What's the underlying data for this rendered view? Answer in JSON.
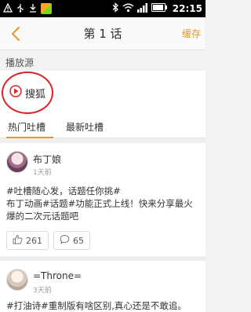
{
  "status_bar": {
    "time": "22:15"
  },
  "header": {
    "title": "第 1 话",
    "cache_label": "缓存"
  },
  "source": {
    "section_label": "播放源",
    "selected": "搜狐"
  },
  "tabs": [
    {
      "label": "热门吐槽",
      "active": true
    },
    {
      "label": "最新吐槽",
      "active": false
    }
  ],
  "posts": [
    {
      "username": "布丁娘",
      "time": "1天前",
      "text": "#吐槽随心发，话题任你挑#\n布丁动画#话题#功能正式上线！快来分享最火爆的二次元话题吧",
      "likes": "261",
      "comments": "65"
    },
    {
      "username": "=Throne=",
      "time": "3天前",
      "text": "#打油诗#重制版有啥区别,真心还是不敢追。"
    }
  ],
  "colors": {
    "accent": "#e8962a",
    "highlight_ring": "#d8252b",
    "sohu_red": "#d8252b"
  }
}
